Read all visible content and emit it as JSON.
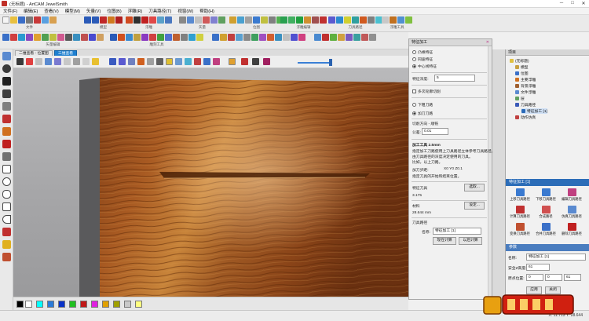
{
  "window": {
    "title": "(无标题) - ArtCAM JewelSmith",
    "min": "─",
    "max": "□",
    "close": "✕"
  },
  "menu": [
    "文件(F)",
    "编辑(E)",
    "查看(V)",
    "模型(M)",
    "矢量(V)",
    "位图(B)",
    "浮雕(R)",
    "刀具路径(T)",
    "视窗(W)",
    "帮助(H)"
  ],
  "toolbar_groups": [
    "文件",
    "模型",
    "浮雕",
    "矢量",
    "位图",
    "浮雕编辑",
    "刀具路径",
    "浮雕工具",
    "矢量编辑",
    "雕刻工具"
  ],
  "view": {
    "tab_2d": "二维查看 - 位置图",
    "tab_3d": "三维查看"
  },
  "palette_colors": [
    "#000000",
    "#ffffff",
    "#00ffff",
    "#2a7bd8",
    "#0a32c8",
    "#20c020",
    "#c01818",
    "#e020e0",
    "#e0a000",
    "#a0a000",
    "#c8c8c8",
    "#ffff80"
  ],
  "feature_panel": {
    "title": "特征加工",
    "close": "✕",
    "strategy_options": [
      "凸缘特征",
      "同途特征",
      "中心线特征"
    ],
    "selected_strategy": 2,
    "depth_label": "特征深度:",
    "depth_value": "5",
    "multi_pass_label": "多次轮廓切削",
    "tool_options": [
      "下粗刀路",
      "加刀刀路"
    ],
    "selected_tool": 1,
    "angle_label": "切削方向 - 顺铣",
    "tolerance_label": "公差:",
    "tolerance_value": "0.01",
    "tool_section_title": "加工工具 2.5mm",
    "tool_desc_1": "指定加工刀路使用上刀具路径立体参考刀具路径。",
    "tool_desc_2": "由刀具路径的深度决定使用的刀具。",
    "tool_desc_3": "比如，以上刀路。",
    "stepover_label": "加刀步距:",
    "stepover_value": "X0 Y0 Z0.1",
    "tool_note": "指定刀具的开始和结束位置。",
    "tool_select_label": "特征刀具",
    "select_btn": "选取...",
    "tool_size": "3.175",
    "material_label": "材料",
    "material_btn": "设定...",
    "material_value": "28.644 mm",
    "name_section": "刀具路径",
    "name_label": "名称:",
    "name_value": "特征加工 [1]",
    "calc_now": "现在计算",
    "calc_later": "以后计算"
  },
  "project_panel": {
    "title": "项目",
    "tree": [
      "(无标题)",
      "模型",
      "位图",
      "主要浮雕",
      "背景浮雕",
      "文件浮雕",
      "层",
      "刀具路径",
      "特征加工 [1]",
      "动作仿真"
    ]
  },
  "toolpath_ops": {
    "title": "特征加工 [1]",
    "buttons": [
      "上移刀具路径",
      "下移刀具路径",
      "编辑刀具路径",
      "计算刀具路径",
      "合成路径",
      "仿真刀具路径",
      "变换刀具路径",
      "合并刀具路径",
      "删除刀具路径"
    ]
  },
  "properties": {
    "title": "参数",
    "name_label": "名称:",
    "name_value": "特征加工 [1]",
    "safe_z_label": "安全Z高度:",
    "safe_z_value": "61",
    "home_label": "原点位置:",
    "home_x": "0",
    "home_y": "0",
    "home_z": "61",
    "ok_btn": "应用",
    "cancel_btn": "关闭"
  },
  "status": {
    "coords": "X: 11.713 Y: 28.644"
  }
}
